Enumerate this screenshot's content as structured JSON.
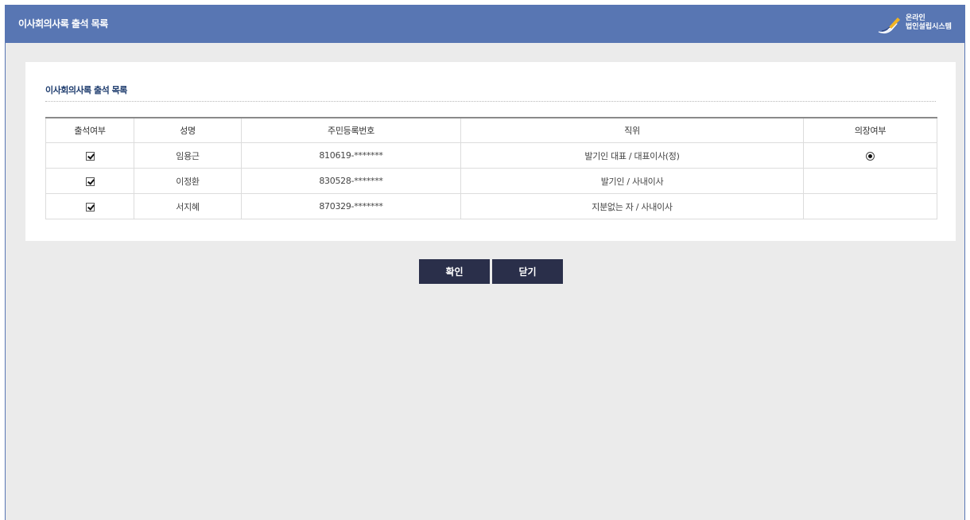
{
  "window": {
    "title": "이사회의사록 출석 목록",
    "brand": {
      "line1": "온라인",
      "line2": "법인설립시스템",
      "icon": "pen-logo-icon"
    }
  },
  "section": {
    "title": "이사회의사록 출석 목록"
  },
  "table": {
    "headers": [
      "출석여부",
      "성명",
      "주민등록번호",
      "직위",
      "의장여부"
    ],
    "rows": [
      {
        "attended": true,
        "name": "임용근",
        "rrn": "810619-*******",
        "position": "발기인 대표 / 대표이사(정)",
        "chair": true
      },
      {
        "attended": true,
        "name": "이정환",
        "rrn": "830528-*******",
        "position": "발기인 / 사내이사",
        "chair": false
      },
      {
        "attended": true,
        "name": "서지혜",
        "rrn": "870329-*******",
        "position": "지분없는 자 / 사내이사",
        "chair": false
      }
    ]
  },
  "buttons": {
    "confirm": "확인",
    "close": "닫기"
  },
  "colors": {
    "titlebar": "#5876b3",
    "button": "#2a2f4a",
    "section_title": "#1e3c6e",
    "background": "#ebebeb"
  }
}
